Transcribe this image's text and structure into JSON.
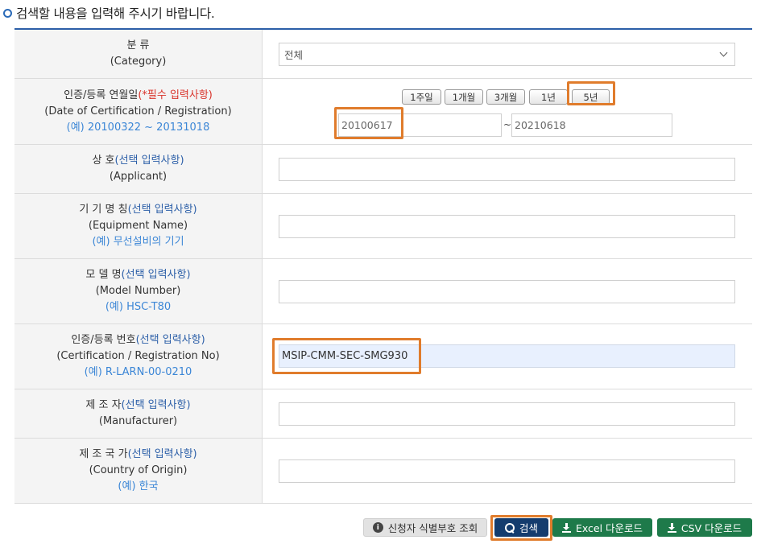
{
  "heading": {
    "title": "검색할 내용을 입력해 주시기 바랍니다."
  },
  "colors": {
    "accent": "#2c5fa8",
    "required": "#d9342b",
    "example": "#3b86d6",
    "highlight": "#e07c2c",
    "search_button": "#143c6e",
    "download_button": "#1e7a4a"
  },
  "category": {
    "label_ko": "분 류",
    "label_en": "(Category)",
    "selected": "전체"
  },
  "date": {
    "label_ko": "인증/등록 연월일",
    "required_note": "(*필수 입력사항)",
    "label_en": "(Date of Certification / Registration)",
    "example": "(예) 20100322 ~ 20131018",
    "periods": [
      "1주일",
      "1개월",
      "3개월",
      "1년",
      "5년"
    ],
    "start": "20100617",
    "separator": "~",
    "end": "20210618"
  },
  "applicant": {
    "label_ko": "상 호",
    "optional_note": "(선택 입력사항)",
    "label_en": "(Applicant)",
    "value": ""
  },
  "equipment": {
    "label_ko": "기 기 명 칭",
    "optional_note": "(선택 입력사항)",
    "label_en": "(Equipment Name)",
    "example": "(예) 무선설비의 기기",
    "value": ""
  },
  "model": {
    "label_ko": "모 델 명",
    "optional_note": "(선택 입력사항)",
    "label_en": "(Model Number)",
    "example": "(예) HSC-T80",
    "value": ""
  },
  "cert_no": {
    "label_ko": "인증/등록 번호",
    "optional_note": "(선택 입력사항)",
    "label_en": "(Certification / Registration No)",
    "example": "(예) R-LARN-00-0210",
    "value": "MSIP-CMM-SEC-SMG930"
  },
  "manufacturer": {
    "label_ko": "제 조 자",
    "optional_note": "(선택 입력사항)",
    "label_en": "(Manufacturer)",
    "value": ""
  },
  "country": {
    "label_ko": "제 조 국 가",
    "optional_note": "(선택 입력사항)",
    "label_en": "(Country of Origin)",
    "example": "(예) 한국",
    "value": ""
  },
  "buttons": {
    "applicant_lookup": "신청자 식별부호 조회",
    "search": "검색",
    "excel": "Excel 다운로드",
    "csv": "CSV 다운로드"
  },
  "icons": {
    "heading": "circle-bullet-icon",
    "lookup": "info-icon",
    "search": "search-icon",
    "download": "download-icon",
    "select": "chevron-down-icon"
  }
}
